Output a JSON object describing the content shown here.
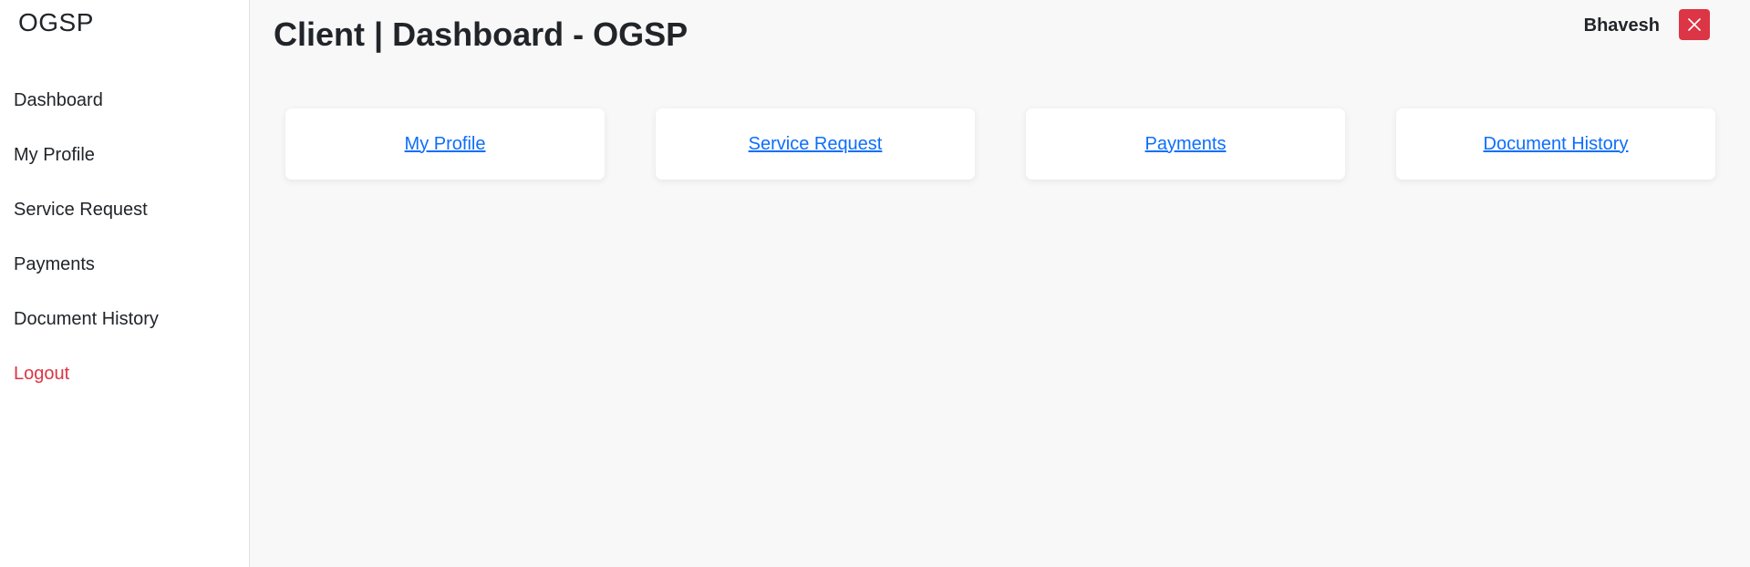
{
  "sidebar": {
    "brand": "OGSP",
    "items": [
      {
        "label": "Dashboard"
      },
      {
        "label": "My Profile"
      },
      {
        "label": "Service Request"
      },
      {
        "label": "Payments"
      },
      {
        "label": "Document History"
      },
      {
        "label": "Logout"
      }
    ]
  },
  "header": {
    "title": "Client | Dashboard - OGSP",
    "user_name": "Bhavesh",
    "close_icon": "close-icon"
  },
  "cards": [
    {
      "label": "My Profile"
    },
    {
      "label": "Service Request"
    },
    {
      "label": "Payments"
    },
    {
      "label": "Document History"
    }
  ],
  "colors": {
    "link": "#0d6efd",
    "danger": "#dc3545",
    "background": "#f8f8f8",
    "sidebar_bg": "#ffffff"
  }
}
